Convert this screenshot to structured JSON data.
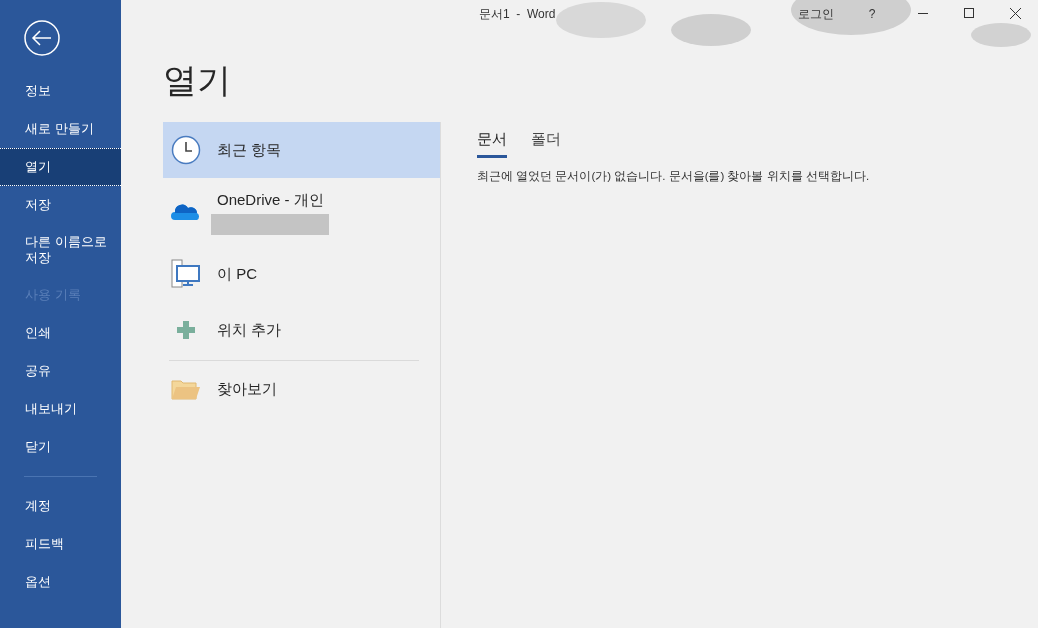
{
  "window": {
    "title": "문서1  -  Word",
    "sign_in": "로그인",
    "help": "?"
  },
  "sidebar": {
    "items": [
      {
        "label": "정보",
        "selected": false,
        "disabled": false
      },
      {
        "label": "새로 만들기",
        "selected": false,
        "disabled": false
      },
      {
        "label": "열기",
        "selected": true,
        "disabled": false
      },
      {
        "label": "저장",
        "selected": false,
        "disabled": false
      },
      {
        "label": "다른 이름으로 저장",
        "selected": false,
        "disabled": false
      },
      {
        "label": "사용 기록",
        "selected": false,
        "disabled": true
      },
      {
        "label": "인쇄",
        "selected": false,
        "disabled": false
      },
      {
        "label": "공유",
        "selected": false,
        "disabled": false
      },
      {
        "label": "내보내기",
        "selected": false,
        "disabled": false
      },
      {
        "label": "닫기",
        "selected": false,
        "disabled": false
      }
    ],
    "bottom_items": [
      {
        "label": "계정",
        "selected": false
      },
      {
        "label": "피드백",
        "selected": false
      },
      {
        "label": "옵션",
        "selected": false
      }
    ]
  },
  "page_title": "열기",
  "places": [
    {
      "kind": "recent",
      "label": "최근 항목",
      "selected": true
    },
    {
      "kind": "onedrive",
      "label": "OneDrive - 개인",
      "selected": false,
      "redacted": true
    },
    {
      "kind": "pc",
      "label": "이 PC",
      "selected": false
    },
    {
      "kind": "add",
      "label": "위치 추가",
      "selected": false
    }
  ],
  "browse": {
    "kind": "folder",
    "label": "찾아보기"
  },
  "tabs": [
    {
      "label": "문서",
      "selected": true
    },
    {
      "label": "폴더",
      "selected": false
    }
  ],
  "empty_message": "최근에 열었던 문서이(가) 없습니다. 문서을(를) 찾아볼 위치를 선택합니다."
}
